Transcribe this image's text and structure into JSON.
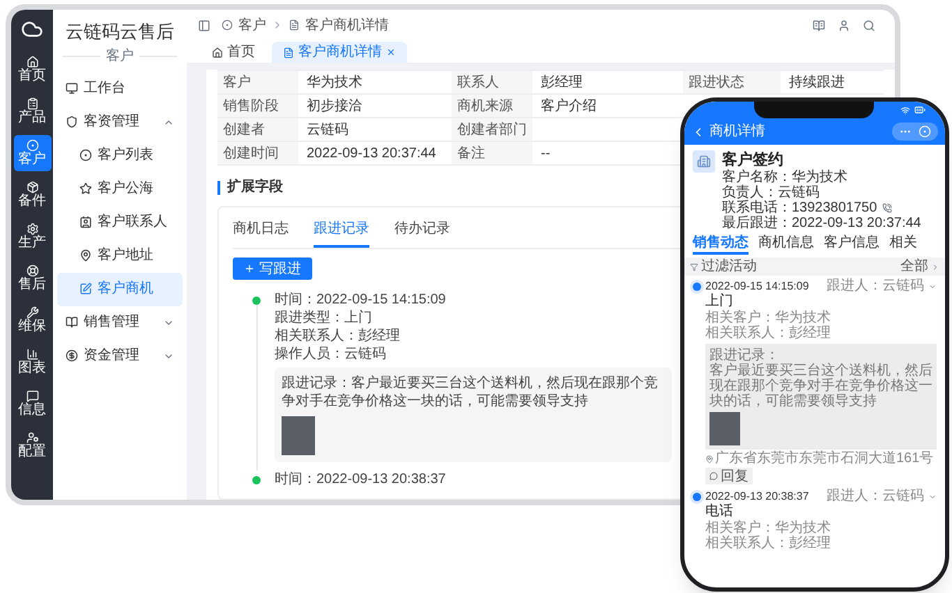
{
  "app": {
    "name": "云链码云售后",
    "module": "客户"
  },
  "rail": [
    {
      "label": "首页",
      "selected": false
    },
    {
      "label": "产品",
      "selected": false
    },
    {
      "label": "客户",
      "selected": true
    },
    {
      "label": "备件",
      "selected": false
    },
    {
      "label": "生产",
      "selected": false
    },
    {
      "label": "售后",
      "selected": false
    },
    {
      "label": "维保",
      "selected": false
    },
    {
      "label": "图表",
      "selected": false
    },
    {
      "label": "信息",
      "selected": false
    },
    {
      "label": "配置",
      "selected": false
    }
  ],
  "menu": [
    {
      "label": "工作台",
      "kind": "link",
      "selected": false
    },
    {
      "label": "客资管理",
      "kind": "group",
      "selected": false,
      "expanded": true,
      "children": [
        {
          "label": "客户列表",
          "selected": false
        },
        {
          "label": "客户公海",
          "selected": false
        },
        {
          "label": "客户联系人",
          "selected": false
        },
        {
          "label": "客户地址",
          "selected": false
        },
        {
          "label": "客户商机",
          "selected": true
        }
      ]
    },
    {
      "label": "销售管理",
      "kind": "group",
      "selected": false,
      "expanded": false
    },
    {
      "label": "资金管理",
      "kind": "group",
      "selected": false,
      "expanded": false
    }
  ],
  "breadcrumb": [
    "客户",
    "客户商机详情"
  ],
  "tabs": [
    {
      "label": "首页",
      "selected": false,
      "closable": false
    },
    {
      "label": "客户商机详情",
      "selected": true,
      "closable": true
    }
  ],
  "details": [
    {
      "fields": [
        {
          "label": "客户",
          "value": "华为技术"
        },
        {
          "label": "联系人",
          "value": "彭经理"
        },
        {
          "label": "跟进状态",
          "value": "持续跟进"
        }
      ]
    },
    {
      "fields": [
        {
          "label": "销售阶段",
          "value": "初步接洽"
        },
        {
          "label": "商机来源",
          "value": "客户介绍"
        }
      ]
    },
    {
      "fields": [
        {
          "label": "创建者",
          "value": "云链码"
        },
        {
          "label": "创建者部门"
        }
      ]
    },
    {
      "fields": [
        {
          "label": "创建时间",
          "value": "2022-09-13 20:37:44"
        },
        {
          "label": "备注",
          "value": "--"
        }
      ]
    }
  ],
  "section_title": "扩展字段",
  "record_tabs": [
    {
      "label": "商机日志",
      "selected": false
    },
    {
      "label": "跟进记录",
      "selected": true
    },
    {
      "label": "待办记录",
      "selected": false
    }
  ],
  "add_button": "写跟进",
  "timeline": [
    {
      "lines": [
        "时间：2022-09-15 14:15:09",
        "跟进类型：上门",
        "相关联系人：彭经理",
        "操作人员：云链码"
      ],
      "note": "跟进记录：客户最近要买三台这个送料机，然后现在跟那个竞争对手在竞争价格这一块的话，可能需要领导支持"
    },
    {
      "lines": [
        "时间：2022-09-13 20:38:37"
      ]
    }
  ],
  "phone": {
    "title": "商机详情",
    "stage": "客户签约",
    "fields": [
      {
        "text": "客户名称：华为技术",
        "kind": "text"
      },
      {
        "text": "负责人：云链码",
        "kind": "text"
      },
      {
        "text": "联系电话：13923801750",
        "kind": "phone"
      },
      {
        "text": "最后跟进：2022-09-13 20:37:44",
        "kind": "text"
      }
    ],
    "tabs": [
      {
        "label": "销售动态",
        "selected": true
      },
      {
        "label": "商机信息",
        "selected": false
      },
      {
        "label": "客户信息",
        "selected": false
      },
      {
        "label": "相关",
        "selected": false
      }
    ],
    "filter": "过滤活动",
    "filter_all": "全部",
    "feed": [
      {
        "time": "2022-09-15 14:15:09",
        "owner": "跟进人：云链码",
        "type": "上门",
        "related": [
          "相关客户：华为技术",
          "相关联系人：彭经理"
        ],
        "note_title": "跟进记录：",
        "note": "客户最近要买三台这个送料机，然后现在跟那个竞争对手在竞争价格这一块的话，可能需要领导支持",
        "location": "广东省东莞市东莞市石洞大道161号",
        "reply": "回复"
      },
      {
        "time": "2022-09-13 20:38:37",
        "owner": "跟进人：云链码",
        "type": "电话",
        "related": [
          "相关客户：华为技术",
          "相关联系人：彭经理"
        ]
      }
    ]
  }
}
